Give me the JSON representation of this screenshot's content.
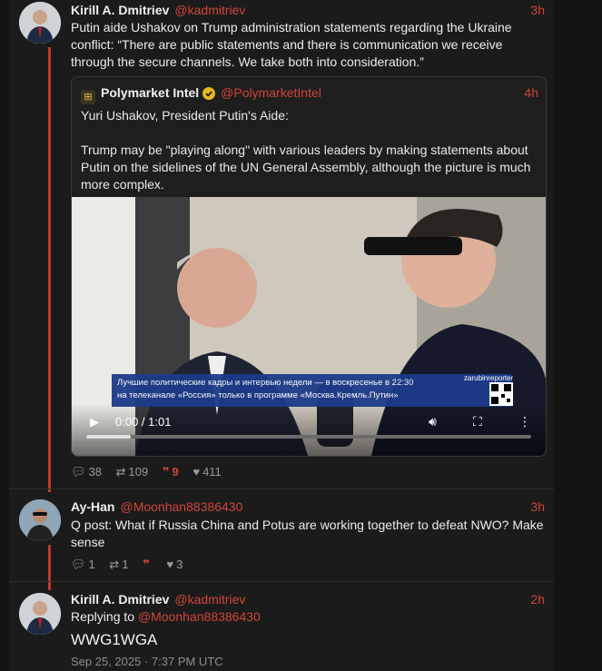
{
  "posts": [
    {
      "author": "Kirill A. Dmitriev",
      "handle": "@kadmitriev",
      "time": "3h",
      "text": "Putin aide Ushakov on Trump administration statements regarding the Ukraine conflict:  “There are public statements and there is communication we receive through the secure channels. We take both into consideration.”",
      "quote": {
        "author": "Polymarket Intel",
        "handle": "@PolymarketIntel",
        "time": "4h",
        "line1": "Yuri Ushakov, President Putin's Aide:",
        "line2": "Trump may be \"playing along\" with various leaders by making statements about Putin on the sidelines of the UN General Assembly, although the picture is much more complex.",
        "video": {
          "ticker_line1": "Лучшие политические кадры и интервью недели — в воскресенье в 22:30",
          "ticker_line2": "на телеканале «Россия» только в программе «Москва.Кремль.Путин»",
          "ticker_tag": "zarubinreporter",
          "time_display": "0:00 / 1:01",
          "progress": 0.1
        }
      },
      "stats": {
        "replies": "38",
        "reposts": "109",
        "quotes": "9",
        "likes": "411"
      }
    },
    {
      "author": "Ay-Han",
      "handle": "@Moonhan88386430",
      "time": "3h",
      "text": "Q post: What if Russia China and Potus are working together to defeat NWO? Make sense",
      "stats": {
        "replies": "1",
        "reposts": "1",
        "likes": "3"
      }
    },
    {
      "author": "Kirill A. Dmitriev",
      "handle": "@kadmitriev",
      "time": "2h",
      "replying_prefix": "Replying to",
      "replying_handle": "@Moonhan88386430",
      "text": "WWG1WGA",
      "date": "Sep 25, 2025 · 7:37 PM UTC"
    }
  ],
  "colors": {
    "accent": "#d0453b",
    "background": "#1b1b1b",
    "text": "#ececec"
  }
}
